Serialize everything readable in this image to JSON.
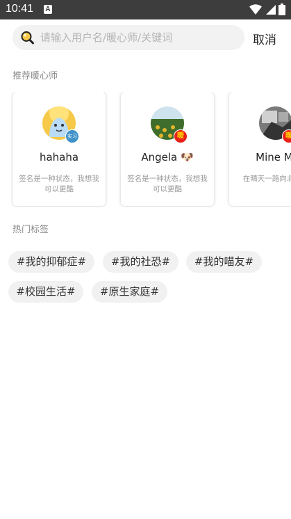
{
  "status_bar": {
    "time": "10:41",
    "notif_icon": "A"
  },
  "search": {
    "placeholder": "请输入用户名/暖心师/关键词",
    "cancel_label": "取消"
  },
  "recommend": {
    "title": "推荐暖心师",
    "cards": [
      {
        "name": "hahaha",
        "bio": "签名是一种状态，我想我可以更酷",
        "badge": "实习"
      },
      {
        "name": "Angela 🐶",
        "bio": "签名是一种状态，我想我可以更酷",
        "badge": "暖"
      },
      {
        "name": "Mine Mi",
        "bio": "在晴天一路向北海吗",
        "badge": "暖"
      }
    ]
  },
  "hot_tags": {
    "title": "热门标签",
    "tags": [
      "#我的抑郁症#",
      "#我的社恐#",
      "#我的喵友#",
      "#校园生活#",
      "#原生家庭#"
    ]
  },
  "colors": {
    "status_bg": "#3d3d3d",
    "badge_warm": "#e8211a",
    "badge_study": "#3d91c9",
    "tag_bg": "#f1f1f1"
  }
}
